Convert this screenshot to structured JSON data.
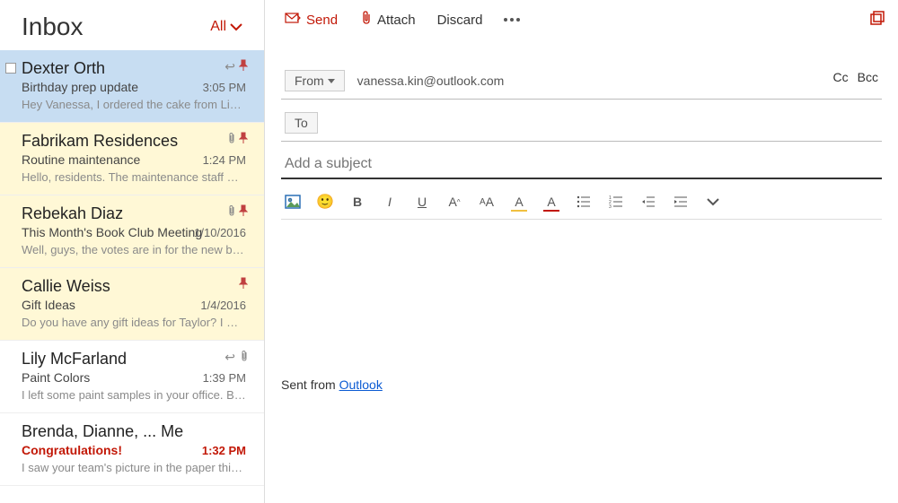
{
  "filter": {
    "label": "All"
  },
  "inbox": {
    "title": "Inbox",
    "messages": [
      {
        "from": "Dexter Orth",
        "subject": "Birthday prep update",
        "preview": "Hey Vanessa, I ordered the cake from Liber...",
        "time": "3:05 PM",
        "selected": true,
        "pinned": true,
        "reply": true
      },
      {
        "from": "Fabrikam Residences",
        "subject": "Routine maintenance",
        "preview": "Hello, residents. The maintenance staff will...",
        "time": "1:24 PM",
        "yellow": true,
        "pinned": true,
        "attach": true
      },
      {
        "from": "Rebekah Diaz",
        "subject": "This Month's Book Club Meeting",
        "preview": "Well, guys, the votes are in for the new bo...",
        "time": "1/10/2016",
        "yellow": true,
        "pinned": true,
        "attach": true
      },
      {
        "from": "Callie Weiss",
        "subject": "Gift Ideas",
        "preview": "Do you have any gift ideas for Taylor? I wa...",
        "time": "1/4/2016",
        "yellow": true,
        "pinned": true
      },
      {
        "from": "Lily McFarland",
        "subject": "Paint Colors",
        "preview": "I left some paint samples in your office. Be...",
        "time": "1:39 PM",
        "reply": true,
        "attach": true
      },
      {
        "from": "Brenda, Dianne, ... Me",
        "subject": "Congratulations!",
        "preview": "I saw your team's picture in the paper this...",
        "time": "1:32 PM",
        "unread": true
      }
    ]
  },
  "toolbar": {
    "send": "Send",
    "attach": "Attach",
    "discard": "Discard"
  },
  "compose": {
    "from_label": "From",
    "from_value": "vanessa.kin@outlook.com",
    "to_label": "To",
    "cc": "Cc",
    "bcc": "Bcc",
    "subject_placeholder": "Add a subject",
    "signature_prefix": "Sent from ",
    "signature_link": "Outlook"
  }
}
